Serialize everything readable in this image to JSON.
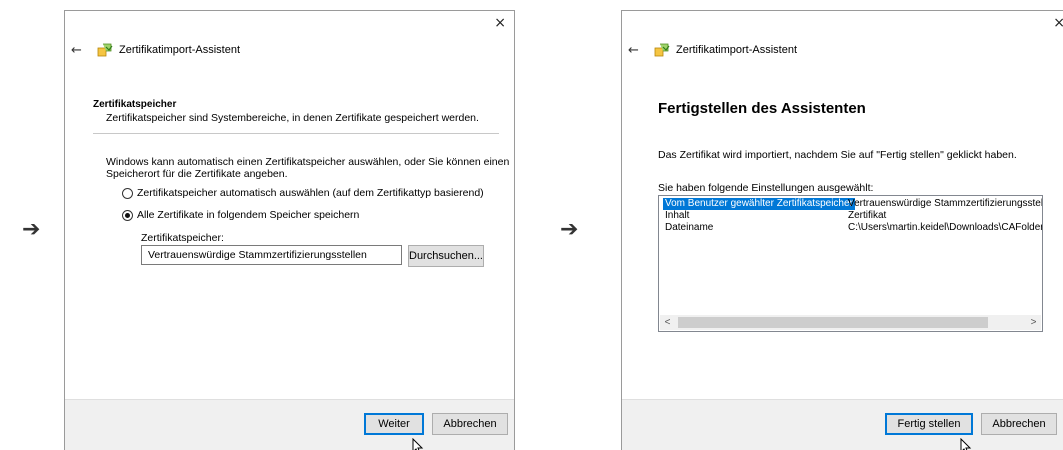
{
  "flow_arrows": [
    "➔",
    "➔"
  ],
  "dialog1": {
    "close": "×",
    "back": "←",
    "title": "Zertifikatimport-Assistent",
    "section_heading": "Zertifikatspeicher",
    "section_desc": "Zertifikatspeicher sind Systembereiche, in denen Zertifikate gespeichert werden.",
    "intro_line1": "Windows kann automatisch einen Zertifikatspeicher auswählen, oder Sie können einen",
    "intro_line2": "Speicherort für die Zertifikate angeben.",
    "radio_auto": "Zertifikatspeicher automatisch auswählen (auf dem Zertifikattyp basierend)",
    "radio_manual": "Alle Zertifikate in folgendem Speicher speichern",
    "store_label": "Zertifikatspeicher:",
    "store_value": "Vertrauenswürdige Stammzertifizierungsstellen",
    "browse_button": "Durchsuchen...",
    "next_button": "Weiter",
    "cancel_button": "Abbrechen"
  },
  "dialog2": {
    "close": "×",
    "back": "←",
    "title": "Zertifikatimport-Assistent",
    "heading": "Fertigstellen des Assistenten",
    "info": "Das Zertifikat wird importiert, nachdem Sie auf \"Fertig stellen\" geklickt haben.",
    "settings_label": "Sie haben folgende Einstellungen ausgewählt:",
    "rows": [
      {
        "key": "Vom Benutzer gewählter Zertifikatspeicher",
        "value": "Vertrauenswürdige Stammzertifizierungsstelle"
      },
      {
        "key": "Inhalt",
        "value": "Zertifikat"
      },
      {
        "key": "Dateiname",
        "value": "C:\\Users\\martin.keidel\\Downloads\\CAFolder\\"
      }
    ],
    "scroll_left": "<",
    "scroll_right": ">",
    "finish_button": "Fertig stellen",
    "cancel_button": "Abbrechen"
  },
  "colors": {
    "selection": "#0078d7",
    "footer": "#f0f0f0",
    "button": "#e1e1e1"
  }
}
